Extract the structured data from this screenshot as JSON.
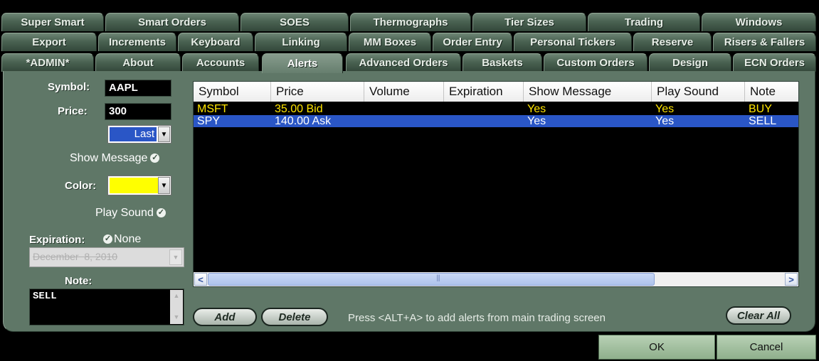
{
  "tabs": {
    "row1": [
      "Super Smart",
      "Smart Orders",
      "SOES",
      "Thermographs",
      "Tier Sizes",
      "Trading",
      "Windows"
    ],
    "row2": [
      "Export",
      "Increments",
      "Keyboard",
      "Linking",
      "MM Boxes",
      "Order Entry",
      "Personal Tickers",
      "Reserve",
      "Risers & Fallers"
    ],
    "row3": [
      "*ADMIN*",
      "About",
      "Accounts",
      "Alerts",
      "Advanced Orders",
      "Baskets",
      "Custom Orders",
      "Design",
      "ECN Orders"
    ],
    "active": "Alerts"
  },
  "form": {
    "symbol_label": "Symbol:",
    "symbol_value": "AAPL",
    "price_label": "Price:",
    "price_value": "300",
    "price_type": "Last",
    "show_message_label": "Show Message",
    "show_message_checked": true,
    "color_label": "Color:",
    "color_value": "#ffff00",
    "play_sound_label": "Play Sound",
    "play_sound_checked": true,
    "expiration_label": "Expiration:",
    "expiration_none_label": "None",
    "expiration_none_checked": true,
    "expiration_date": "December  8, 2010",
    "note_label": "Note:",
    "note_value": "SELL"
  },
  "alerts_table": {
    "columns": [
      "Symbol",
      "Price",
      "Volume",
      "Expiration",
      "Show Message",
      "Play Sound",
      "Note"
    ],
    "rows": [
      {
        "symbol": "MSFT",
        "price": "35.00 Bid",
        "volume": "",
        "expiration": "",
        "show_message": "Yes",
        "play_sound": "Yes",
        "note": "BUY",
        "selected": false
      },
      {
        "symbol": "SPY",
        "price": "140.00 Ask",
        "volume": "",
        "expiration": "",
        "show_message": "Yes",
        "play_sound": "Yes",
        "note": "SELL",
        "selected": true
      }
    ],
    "scroll_grip": "|||",
    "scroll_left": "<",
    "scroll_right": ">"
  },
  "actions": {
    "add_label": "Add",
    "delete_label": "Delete",
    "hint": "Press <ALT+A> to add alerts from main trading screen",
    "clear_all_label": "Clear All"
  },
  "footer": {
    "ok_label": "OK",
    "cancel_label": "Cancel"
  },
  "icons": {
    "dropdown": "chevron-down-icon",
    "check": "check-icon"
  },
  "colors": {
    "panel": "#5f7767",
    "list_text": "#ffe400",
    "selection": "#2a56c6",
    "buttons": "#a8c4a5"
  }
}
